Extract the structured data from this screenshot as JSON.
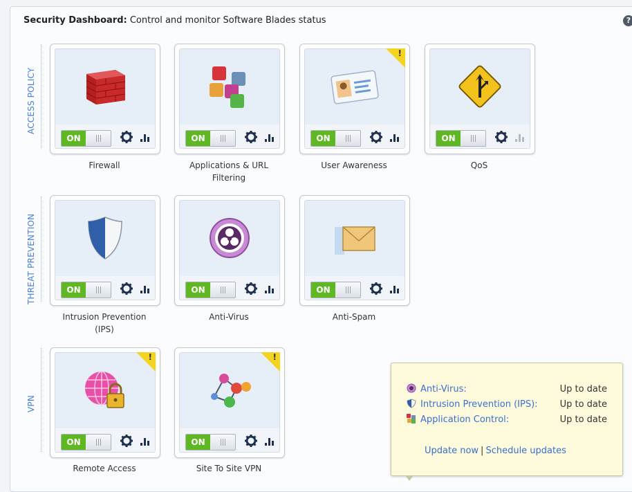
{
  "header": {
    "bold": "Security Dashboard:",
    "rest": " Control and monitor Software Blades status",
    "help": "?"
  },
  "sections": {
    "access_policy": "ACCESS POLICY",
    "threat_prevention": "THREAT PREVENTION",
    "vpn": "VPN"
  },
  "toggle_label": "ON",
  "warning_mark": "!",
  "blades": {
    "firewall": {
      "caption": "Firewall"
    },
    "app_url": {
      "caption_line1": "Applications & URL",
      "caption_line2": "Filtering"
    },
    "user_awareness": {
      "caption": "User Awareness"
    },
    "qos": {
      "caption": "QoS"
    },
    "ips": {
      "caption_line1": "Intrusion Prevention",
      "caption_line2": "(IPS)"
    },
    "antivirus": {
      "caption": "Anti-Virus"
    },
    "antispam": {
      "caption": "Anti-Spam"
    },
    "remote_access": {
      "caption": "Remote Access"
    },
    "site_vpn": {
      "caption": "Site To Site VPN"
    }
  },
  "popup": {
    "rows": [
      {
        "name": "Anti-Virus:",
        "status": "Up to date"
      },
      {
        "name": "Intrusion Prevention (IPS):",
        "status": "Up to date"
      },
      {
        "name": "Application Control:",
        "status": "Up to date"
      }
    ],
    "update_now": "Update now",
    "separator": "|",
    "schedule": "Schedule updates"
  }
}
